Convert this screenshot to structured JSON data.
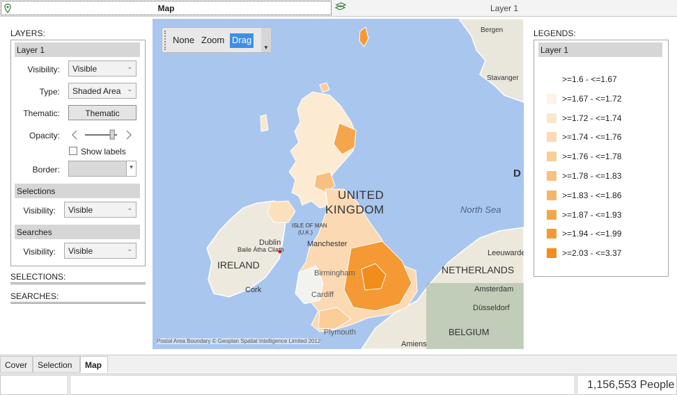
{
  "top_tabs": {
    "map_label": "Map",
    "layer_label": "Layer 1"
  },
  "left_panel": {
    "layers_heading": "LAYERS:",
    "layer_name": "Layer 1",
    "visibility_label": "Visibility:",
    "visibility_value": "Visible",
    "type_label": "Type:",
    "type_value": "Shaded Area",
    "thematic_label": "Thematic:",
    "thematic_button": "Thematic",
    "opacity_label": "Opacity:",
    "opacity_value": 0.85,
    "show_labels": "Show labels",
    "border_label": "Border:",
    "selections_header": "Selections",
    "selections_visibility_label": "Visibility:",
    "selections_visibility_value": "Visible",
    "searches_header": "Searches",
    "searches_visibility_label": "Visibility:",
    "searches_visibility_value": "Visible",
    "selections_heading": "SELECTIONS:",
    "searches_heading": "SEARCHES:"
  },
  "map": {
    "toolbar": {
      "none": "None",
      "zoom": "Zoom",
      "drag": "Drag",
      "active": "Drag"
    },
    "labels": {
      "bergen": "Bergen",
      "stavanger": "Stavanger",
      "d_edge": "D",
      "united": "UNITED",
      "kingdom": "KINGDOM",
      "north_sea": "North Sea",
      "isle_of_man": "ISLE OF MAN",
      "uk_paren": "(U.K.)",
      "manchester": "Manchester",
      "dublin": "Dublin",
      "baile": "Baile Átha Cliath",
      "ireland": "IRELAND",
      "birmingham": "Birmingham",
      "cork": "Cork",
      "cardiff": "Cardiff",
      "netherlands": "NETHERLANDS",
      "leeuwarden": "Leeuwarden",
      "amsterdam": "Amsterdam",
      "dusseldorf": "Düsseldorf",
      "belgium": "BELGIUM",
      "plymouth": "Plymouth",
      "amiens": "Amiens"
    },
    "copyright": "Postal Area Boundary © Geoplan Spatial Intelligence Limited 2012"
  },
  "legend": {
    "heading": "LEGENDS:",
    "layer_name": "Layer 1",
    "items": [
      {
        "label": ">=1.6 - <=1.67",
        "color": "#ffffff"
      },
      {
        "label": ">=1.67 - <=1.72",
        "color": "#fdf3e6"
      },
      {
        "label": ">=1.72 - <=1.74",
        "color": "#fce6cc"
      },
      {
        "label": ">=1.74 - <=1.76",
        "color": "#fbd9b3"
      },
      {
        "label": ">=1.76 - <=1.78",
        "color": "#facd99"
      },
      {
        "label": ">=1.78 - <=1.83",
        "color": "#f8c080"
      },
      {
        "label": ">=1.83 - <=1.86",
        "color": "#f7b366"
      },
      {
        "label": ">=1.87 - <=1.93",
        "color": "#f5a64d"
      },
      {
        "label": ">=1.94 - <=1.99",
        "color": "#f49933"
      },
      {
        "label": ">=2.03 - <=3.37",
        "color": "#f28c1a"
      }
    ]
  },
  "bottom_tabs": [
    "Cover",
    "Selection",
    "Map"
  ],
  "bottom_active": "Map",
  "status": {
    "count": "1,156,553 People"
  }
}
